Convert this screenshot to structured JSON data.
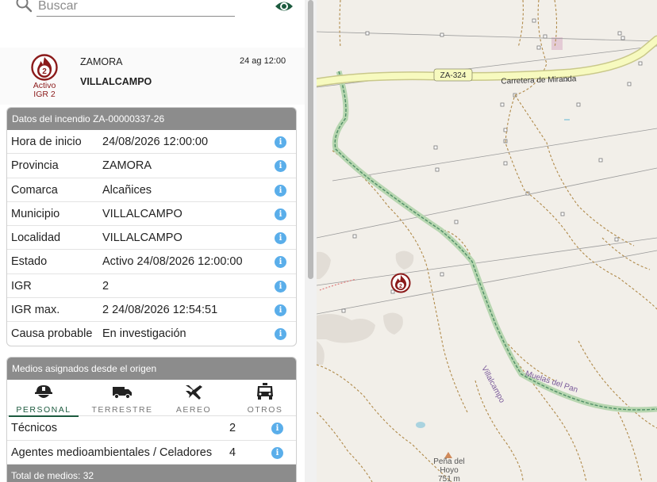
{
  "search": {
    "placeholder": "Buscar"
  },
  "incident": {
    "status_line1": "Activo",
    "status_line2": "IGR 2",
    "igr_badge": "2",
    "provincia": "ZAMORA",
    "municipio": "VILLALCAMPO",
    "fecha": "24 ag 12:00"
  },
  "datos": {
    "title": "Datos del incendio ZA-00000337-26",
    "rows": [
      {
        "label": "Hora de inicio",
        "value": "24/08/2026 12:00:00"
      },
      {
        "label": "Provincia",
        "value": "ZAMORA"
      },
      {
        "label": "Comarca",
        "value": "Alcañices"
      },
      {
        "label": "Municipio",
        "value": "VILLALCAMPO"
      },
      {
        "label": "Localidad",
        "value": "VILLALCAMPO"
      },
      {
        "label": "Estado",
        "value": "Activo 24/08/2026 12:00:00"
      },
      {
        "label": "IGR",
        "value": "2"
      },
      {
        "label": "IGR max.",
        "value": "2 24/08/2026 12:54:51"
      },
      {
        "label": "Causa probable",
        "value": "En investigación"
      }
    ]
  },
  "medios": {
    "title": "Medios asignados desde el origen",
    "tabs": [
      {
        "label": "PERSONAL",
        "icon": "firefighter-helmet-icon"
      },
      {
        "label": "TERRESTRE",
        "icon": "fire-truck-icon"
      },
      {
        "label": "AEREO",
        "icon": "airplane-icon"
      },
      {
        "label": "OTROS",
        "icon": "vehicle-front-icon"
      }
    ],
    "rows": [
      {
        "label": "Técnicos",
        "count": "2"
      },
      {
        "label": "Agentes medioambientales / Celadores",
        "count": "4"
      }
    ],
    "total": "Total de medios: 32"
  },
  "map": {
    "road_ref": "ZA-324",
    "road_name": "Carretera de Miranda",
    "label_villalcampo": "Villalcampo",
    "label_muelas": "Muelas del Pan",
    "peak_line1": "Peña del",
    "peak_line2": "Hoyo",
    "peak_line3": "751 m",
    "marker_igr": "2"
  },
  "colors": {
    "accent": "#1c5a3e",
    "fire": "#8b1a1a",
    "header_bar": "#8c8c8c",
    "info_icon": "#5aaeea",
    "road_yellow": "#f7fabf",
    "boundary_green": "#a9cfa2"
  }
}
